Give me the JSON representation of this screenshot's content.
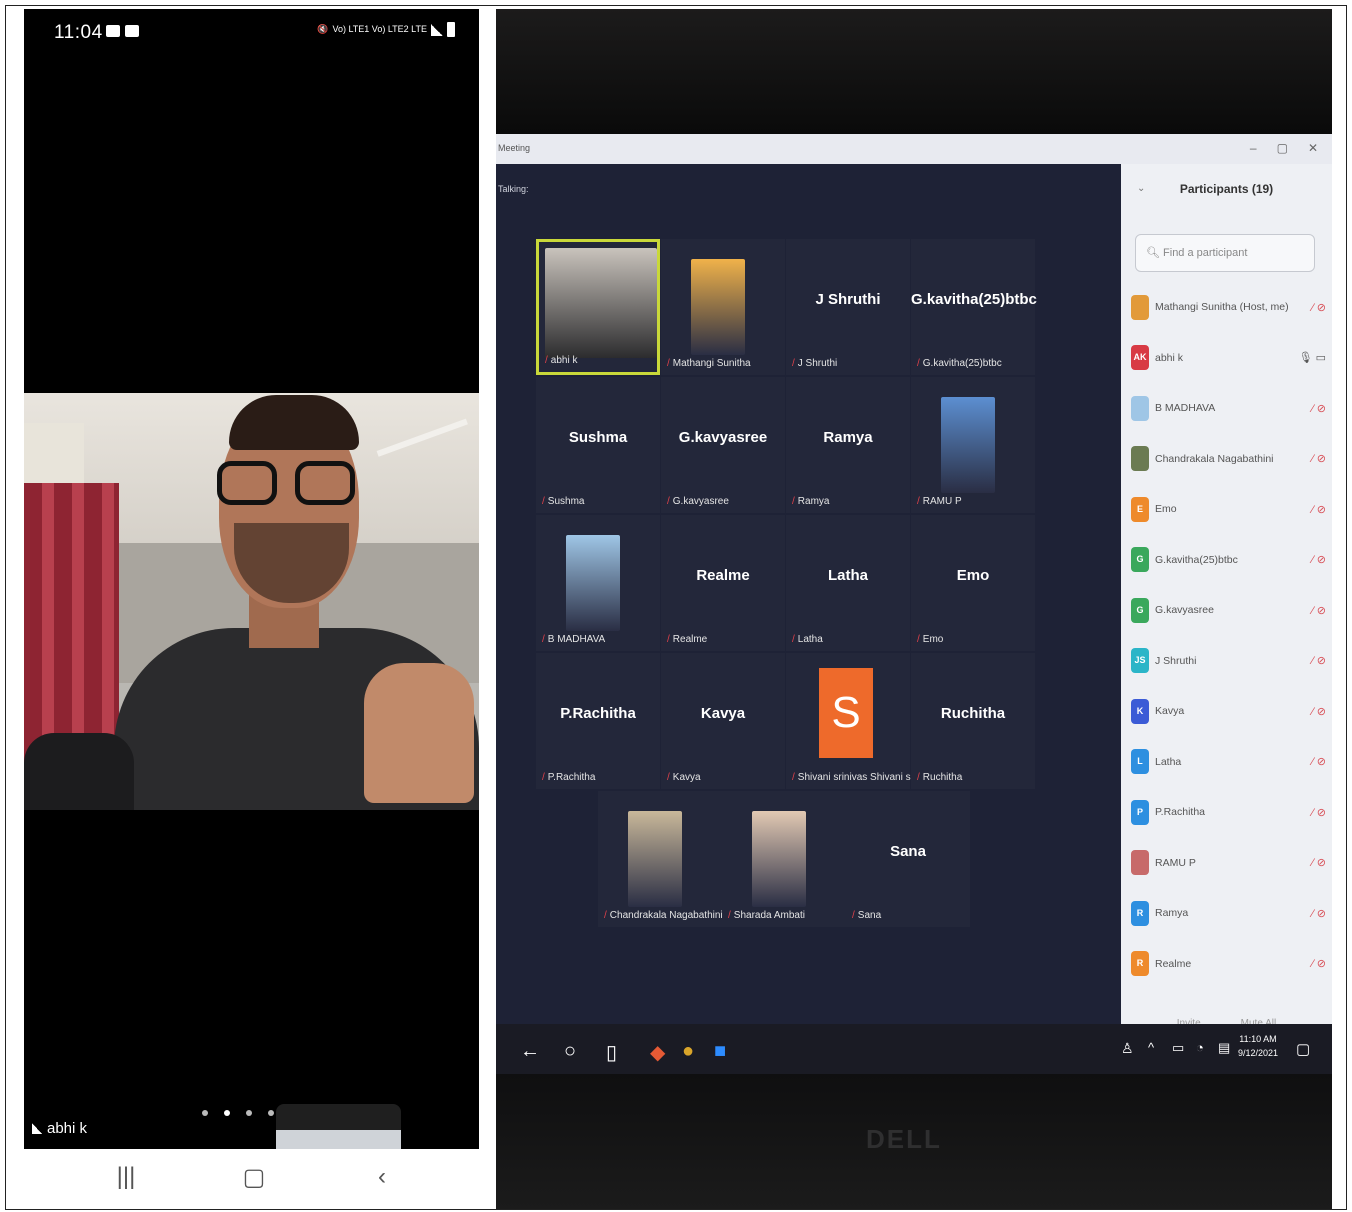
{
  "phone": {
    "time": "11:04",
    "status_right": "Vo) LTE1 Vo) LTE2 LTE",
    "speaker_name": "abhi k",
    "page_dots": 5,
    "active_dot": 1
  },
  "meeting": {
    "window_title": "Meeting",
    "talking": "Talking:",
    "tiles": [
      {
        "big": "",
        "name": "abhi k",
        "type": "video",
        "active": true
      },
      {
        "big": "",
        "name": "Mathangi Sunitha",
        "type": "photo",
        "color": "#f0b24a"
      },
      {
        "big": "J Shruthi",
        "name": "J Shruthi"
      },
      {
        "big": "G.kavitha(25)btbc",
        "name": "G.kavitha(25)btbc"
      },
      {
        "big": "Sushma",
        "name": "Sushma"
      },
      {
        "big": "G.kavyasree",
        "name": "G.kavyasree"
      },
      {
        "big": "Ramya",
        "name": "Ramya"
      },
      {
        "big": "",
        "name": "RAMU P",
        "type": "photo",
        "color": "#5c8fd1"
      },
      {
        "big": "",
        "name": "B MADHAVA",
        "type": "photo",
        "color": "#9fc6e6"
      },
      {
        "big": "Realme",
        "name": "Realme"
      },
      {
        "big": "Latha",
        "name": "Latha"
      },
      {
        "big": "Emo",
        "name": "Emo"
      },
      {
        "big": "P.Rachitha",
        "name": "P.Rachitha"
      },
      {
        "big": "Kavya",
        "name": "Kavya"
      },
      {
        "big": "S",
        "name": "Shivani srinivas Shivani srin...",
        "type": "letter"
      },
      {
        "big": "Ruchitha",
        "name": "Ruchitha"
      },
      {
        "big": "",
        "name": "Chandrakala Nagabathini",
        "type": "photo",
        "color": "#c9b89a"
      },
      {
        "big": "",
        "name": "Sharada Ambati",
        "type": "photo",
        "color": "#e2c9b3"
      },
      {
        "big": "Sana",
        "name": "Sana"
      }
    ],
    "participants_title": "Participants (19)",
    "search_placeholder": "Find a participant",
    "participants": [
      {
        "initials": "",
        "name": "Mathangi Sunitha (Host, me)",
        "color": "#e29a3a"
      },
      {
        "initials": "AK",
        "name": "abhi k",
        "color": "#d83a44"
      },
      {
        "initials": "",
        "name": "B MADHAVA",
        "color": "#9fc6e6"
      },
      {
        "initials": "",
        "name": "Chandrakala Nagabathini",
        "color": "#6b7b52"
      },
      {
        "initials": "E",
        "name": "Emo",
        "color": "#ee8a2b"
      },
      {
        "initials": "G",
        "name": "G.kavitha(25)btbc",
        "color": "#3aa85c"
      },
      {
        "initials": "G",
        "name": "G.kavyasree",
        "color": "#3aa85c"
      },
      {
        "initials": "JS",
        "name": "J Shruthi",
        "color": "#2bb5c8"
      },
      {
        "initials": "K",
        "name": "Kavya",
        "color": "#3b5bd6"
      },
      {
        "initials": "L",
        "name": "Latha",
        "color": "#2d8fe0"
      },
      {
        "initials": "P",
        "name": "P.Rachitha",
        "color": "#2d8fe0"
      },
      {
        "initials": "",
        "name": "RAMU P",
        "color": "#c76a6a"
      },
      {
        "initials": "R",
        "name": "Ramya",
        "color": "#2d8fe0"
      },
      {
        "initials": "R",
        "name": "Realme",
        "color": "#ee8a2b"
      }
    ],
    "footer": {
      "invite": "Invite",
      "mute_all": "Mute All"
    },
    "clock": {
      "time": "11:10 AM",
      "date": "9/12/2021"
    },
    "brand": "DELL"
  }
}
